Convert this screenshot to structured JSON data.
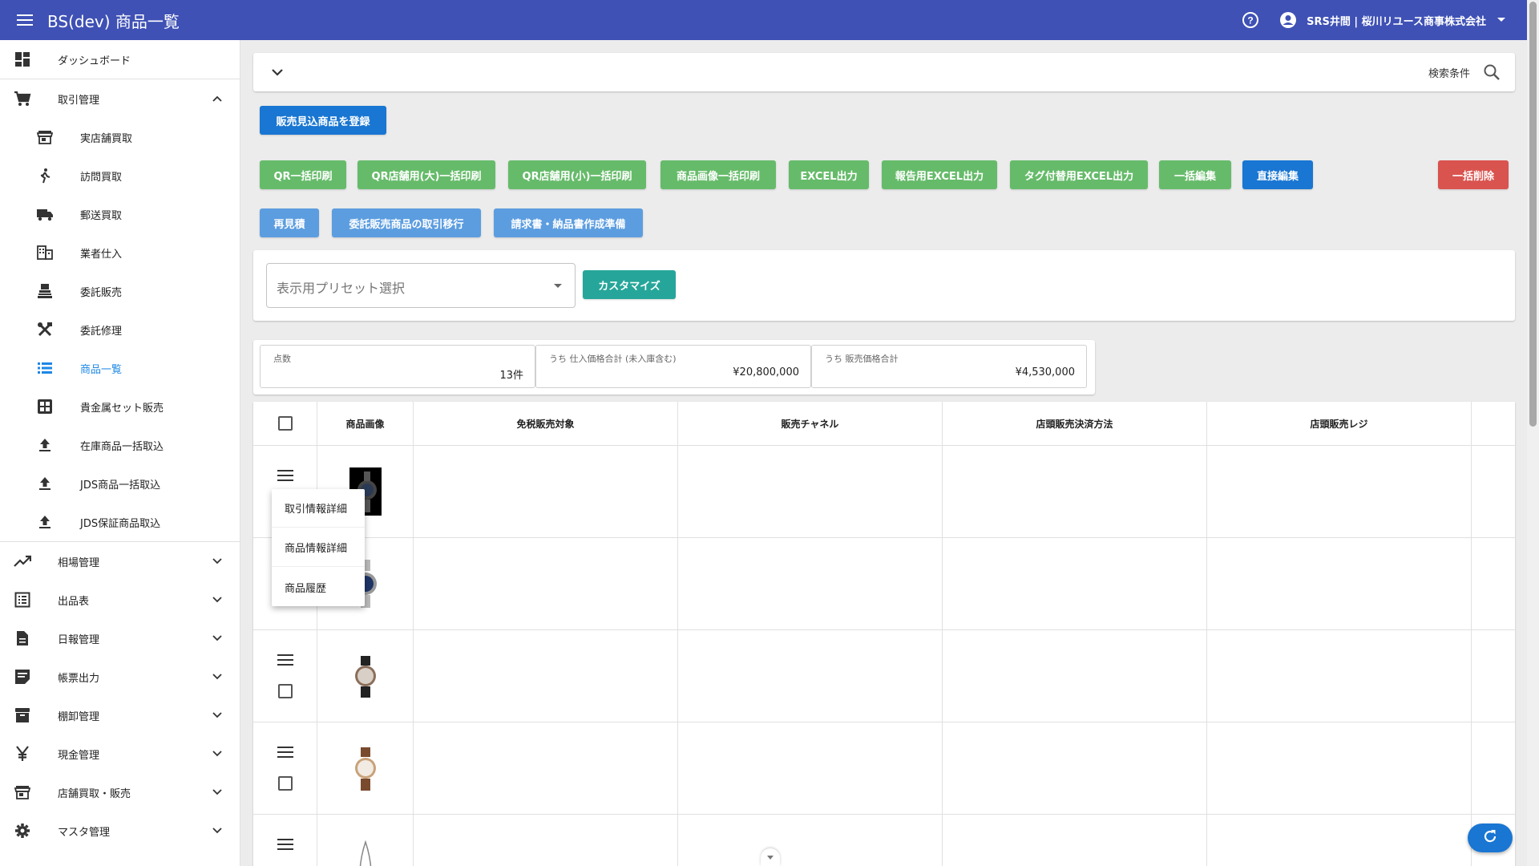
{
  "appbar": {
    "title": "BS(dev) 商品一覧",
    "user": "SRS井間 | 桜川リユース商事株式会社"
  },
  "sidebar": {
    "items": [
      {
        "label": "ダッシュボード",
        "icon": "dashboard-icon"
      },
      {
        "label": "取引管理",
        "icon": "cart-icon",
        "expanded": true
      },
      {
        "label": "実店舗買取",
        "icon": "store-icon"
      },
      {
        "label": "訪問買取",
        "icon": "walk-icon"
      },
      {
        "label": "郵送買取",
        "icon": "truck-icon"
      },
      {
        "label": "業者仕入",
        "icon": "building-icon"
      },
      {
        "label": "委託販売",
        "icon": "consign-icon"
      },
      {
        "label": "委託修理",
        "icon": "tools-icon"
      },
      {
        "label": "商品一覧",
        "icon": "list-icon",
        "active": true
      },
      {
        "label": "貴金属セット販売",
        "icon": "grid-icon"
      },
      {
        "label": "在庫商品一括取込",
        "icon": "upload-icon"
      },
      {
        "label": "JDS商品一括取込",
        "icon": "upload-icon"
      },
      {
        "label": "JDS保証商品取込",
        "icon": "upload-icon"
      },
      {
        "label": "相場管理",
        "icon": "trending-icon"
      },
      {
        "label": "出品表",
        "icon": "listing-icon"
      },
      {
        "label": "日報管理",
        "icon": "document-icon"
      },
      {
        "label": "帳票出力",
        "icon": "note-icon"
      },
      {
        "label": "棚卸管理",
        "icon": "archive-icon"
      },
      {
        "label": "現金管理",
        "icon": "yen-icon"
      },
      {
        "label": "店舗買取・販売",
        "icon": "store-icon"
      },
      {
        "label": "マスタ管理",
        "icon": "gear-icon"
      }
    ]
  },
  "search": {
    "label": "検索条件"
  },
  "buttons": {
    "register": "販売見込商品を登録",
    "qr_bulk": "QR一括印刷",
    "qr_large": "QR店舗用(大)一括印刷",
    "qr_small": "QR店舗用(小)一括印刷",
    "image_print": "商品画像一括印刷",
    "excel": "EXCEL出力",
    "report_excel": "報告用EXCEL出力",
    "tag_excel": "タグ付替用EXCEL出力",
    "bulk_edit": "一括編集",
    "direct_edit": "直接編集",
    "bulk_delete": "一括削除",
    "reestimate": "再見積",
    "consign_move": "委託販売商品の取引移行",
    "invoice_prep": "請求書・納品書作成準備",
    "customize": "カスタマイズ"
  },
  "preset": {
    "placeholder": "表示用プリセット選択"
  },
  "stats": [
    {
      "label": "点数",
      "value": "13件"
    },
    {
      "label": "うち 仕入価格合計 (未入庫含む)",
      "value": "¥20,800,000"
    },
    {
      "label": "うち 販売価格合計",
      "value": "¥4,530,000"
    }
  ],
  "table": {
    "headers": [
      "商品画像",
      "免税販売対象",
      "販売チャネル",
      "店頭販売決済方法",
      "店頭販売レジ"
    ]
  },
  "context_menu": [
    "取引情報詳細",
    "商品情報詳細",
    "商品履歴"
  ],
  "colors": {
    "primary": "#3f51b5",
    "blue": "#1976d2",
    "green": "#66bb6a",
    "red": "#d9534f",
    "light_blue": "#5c9de0",
    "teal": "#26a69a"
  }
}
